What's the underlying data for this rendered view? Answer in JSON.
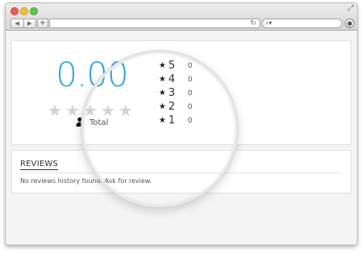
{
  "browser": {
    "nav_back": "◀",
    "nav_forward": "▶",
    "new_tab": "+",
    "reload_icon": "reload-icon",
    "search_icon": "search-icon"
  },
  "rating": {
    "score": "0.00",
    "total_label": "Total",
    "star_count": 5,
    "breakdown": [
      {
        "stars": "5",
        "count": "0"
      },
      {
        "stars": "4",
        "count": "0"
      },
      {
        "stars": "3",
        "count": "0"
      },
      {
        "stars": "2",
        "count": "0"
      },
      {
        "stars": "1",
        "count": "0"
      }
    ]
  },
  "reviews": {
    "title": "REVIEWS",
    "empty_message": "No reviews history found. Ask for review."
  },
  "colors": {
    "score": "#2ba8e0",
    "star_empty": "#d2d2d2"
  }
}
